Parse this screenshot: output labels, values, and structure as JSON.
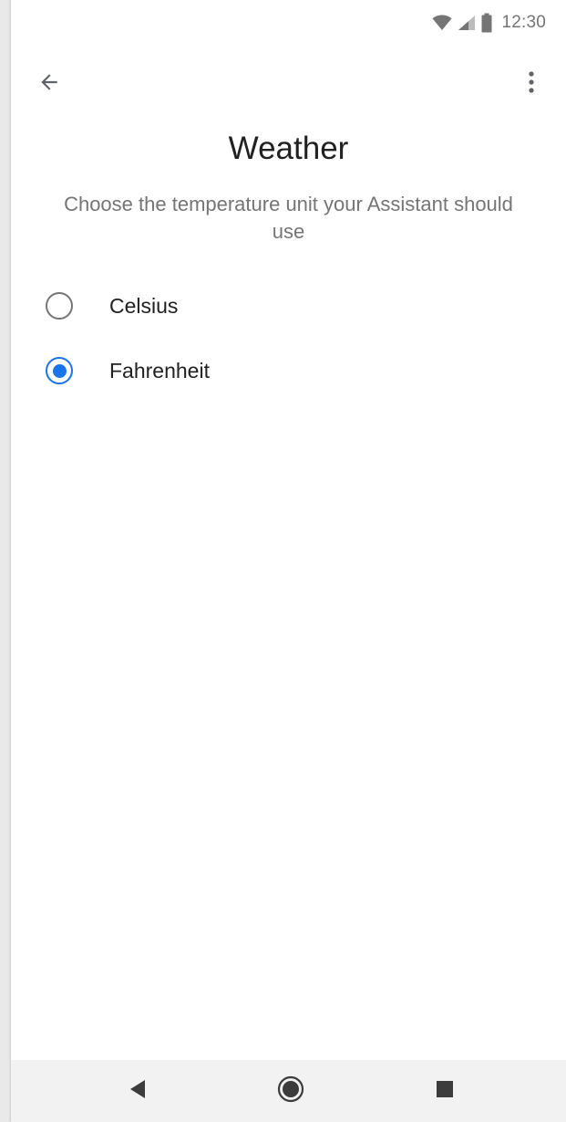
{
  "status_bar": {
    "time": "12:30",
    "icons": [
      "wifi-icon",
      "cellular-signal-icon",
      "battery-icon"
    ]
  },
  "app_bar": {
    "back_icon": "arrow-back-icon",
    "menu_icon": "more-vert-icon"
  },
  "page": {
    "title": "Weather",
    "subtitle": "Choose the temperature unit your Assistant should use"
  },
  "options": [
    {
      "label": "Celsius",
      "selected": false
    },
    {
      "label": "Fahrenheit",
      "selected": true
    }
  ],
  "nav_bar": {
    "icons": [
      "nav-back-icon",
      "nav-home-icon",
      "nav-recents-icon"
    ]
  },
  "colors": {
    "accent": "#1a73e8",
    "text_primary": "#212121",
    "text_secondary": "#757575",
    "nav_background": "#f2f2f2"
  }
}
